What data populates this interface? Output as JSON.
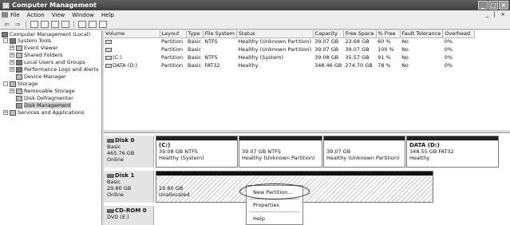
{
  "window": {
    "title": "Computer Management"
  },
  "menu": {
    "items": [
      "File",
      "Action",
      "View",
      "Window",
      "Help"
    ],
    "mdi_controls": "_ | ×"
  },
  "tree": {
    "items": [
      {
        "label": "Computer Management (Local)",
        "expander": "",
        "icon": "computer-icon"
      },
      {
        "label": "System Tools",
        "expander": "-",
        "icon": "tools-icon"
      },
      {
        "label": "Event Viewer",
        "expander": "+",
        "icon": "event-viewer-icon"
      },
      {
        "label": "Shared Folders",
        "expander": "+",
        "icon": "shared-folder-icon"
      },
      {
        "label": "Local Users and Groups",
        "expander": "+",
        "icon": "users-icon"
      },
      {
        "label": "Performance Logs and Alerts",
        "expander": "+",
        "icon": "performance-icon"
      },
      {
        "label": "Device Manager",
        "expander": "",
        "icon": "device-manager-icon"
      },
      {
        "label": "Storage",
        "expander": "-",
        "icon": "storage-icon"
      },
      {
        "label": "Removable Storage",
        "expander": "+",
        "icon": "removable-storage-icon"
      },
      {
        "label": "Disk Defragmenter",
        "expander": "",
        "icon": "defrag-icon"
      },
      {
        "label": "Disk Management",
        "expander": "",
        "icon": "disk-management-icon"
      },
      {
        "label": "Services and Applications",
        "expander": "+",
        "icon": "services-icon"
      }
    ]
  },
  "volumes": {
    "columns": [
      "Volume",
      "Layout",
      "Type",
      "File System",
      "Status",
      "Capacity",
      "Free Space",
      "% Free",
      "Fault Tolerance",
      "Overhead"
    ],
    "rows": [
      [
        "",
        "Partition",
        "Basic",
        "NTFS",
        "Healthy (Unknown Partition)",
        "39.07 GB",
        "23.68 GB",
        "60 %",
        "No",
        "0%"
      ],
      [
        "",
        "Partition",
        "Basic",
        "",
        "Healthy (Unknown Partition)",
        "39.07 GB",
        "39.07 GB",
        "100 %",
        "No",
        "0%"
      ],
      [
        "(C:)",
        "Partition",
        "Basic",
        "NTFS",
        "Healthy (System)",
        "39.08 GB",
        "35.57 GB",
        "91 %",
        "No",
        "0%"
      ],
      [
        "DATA (D:)",
        "Partition",
        "Basic",
        "FAT32",
        "Healthy",
        "348.46 GB",
        "274.70 GB",
        "78 %",
        "No",
        "0%"
      ]
    ]
  },
  "disks": {
    "disk0": {
      "name": "Disk 0",
      "type": "Basic",
      "size": "465.76 GB",
      "status": "Online",
      "partitions": [
        {
          "label": "(C:)",
          "line1": "39.08 GB NTFS",
          "line2": "Healthy (System)"
        },
        {
          "label": "",
          "line1": "39.07 GB NTFS",
          "line2": "Healthy (Unknown Partition)"
        },
        {
          "label": "",
          "line1": "39.07 GB",
          "line2": "Healthy (Unknown Partition)"
        },
        {
          "label": "DATA (D:)",
          "line1": "348.55 GB FAT32",
          "line2": "Healthy"
        }
      ]
    },
    "disk1": {
      "name": "Disk 1",
      "type": "Basic",
      "size": "29.80 GB",
      "status": "Online",
      "unallocated": {
        "size": "29.80 GB",
        "label": "Unallocated"
      }
    },
    "cdrom0": {
      "name": "CD-ROM 0",
      "type": "DVD (E:)"
    }
  },
  "context_menu": {
    "items": [
      "New Partition...",
      "Properties",
      "Help"
    ]
  }
}
